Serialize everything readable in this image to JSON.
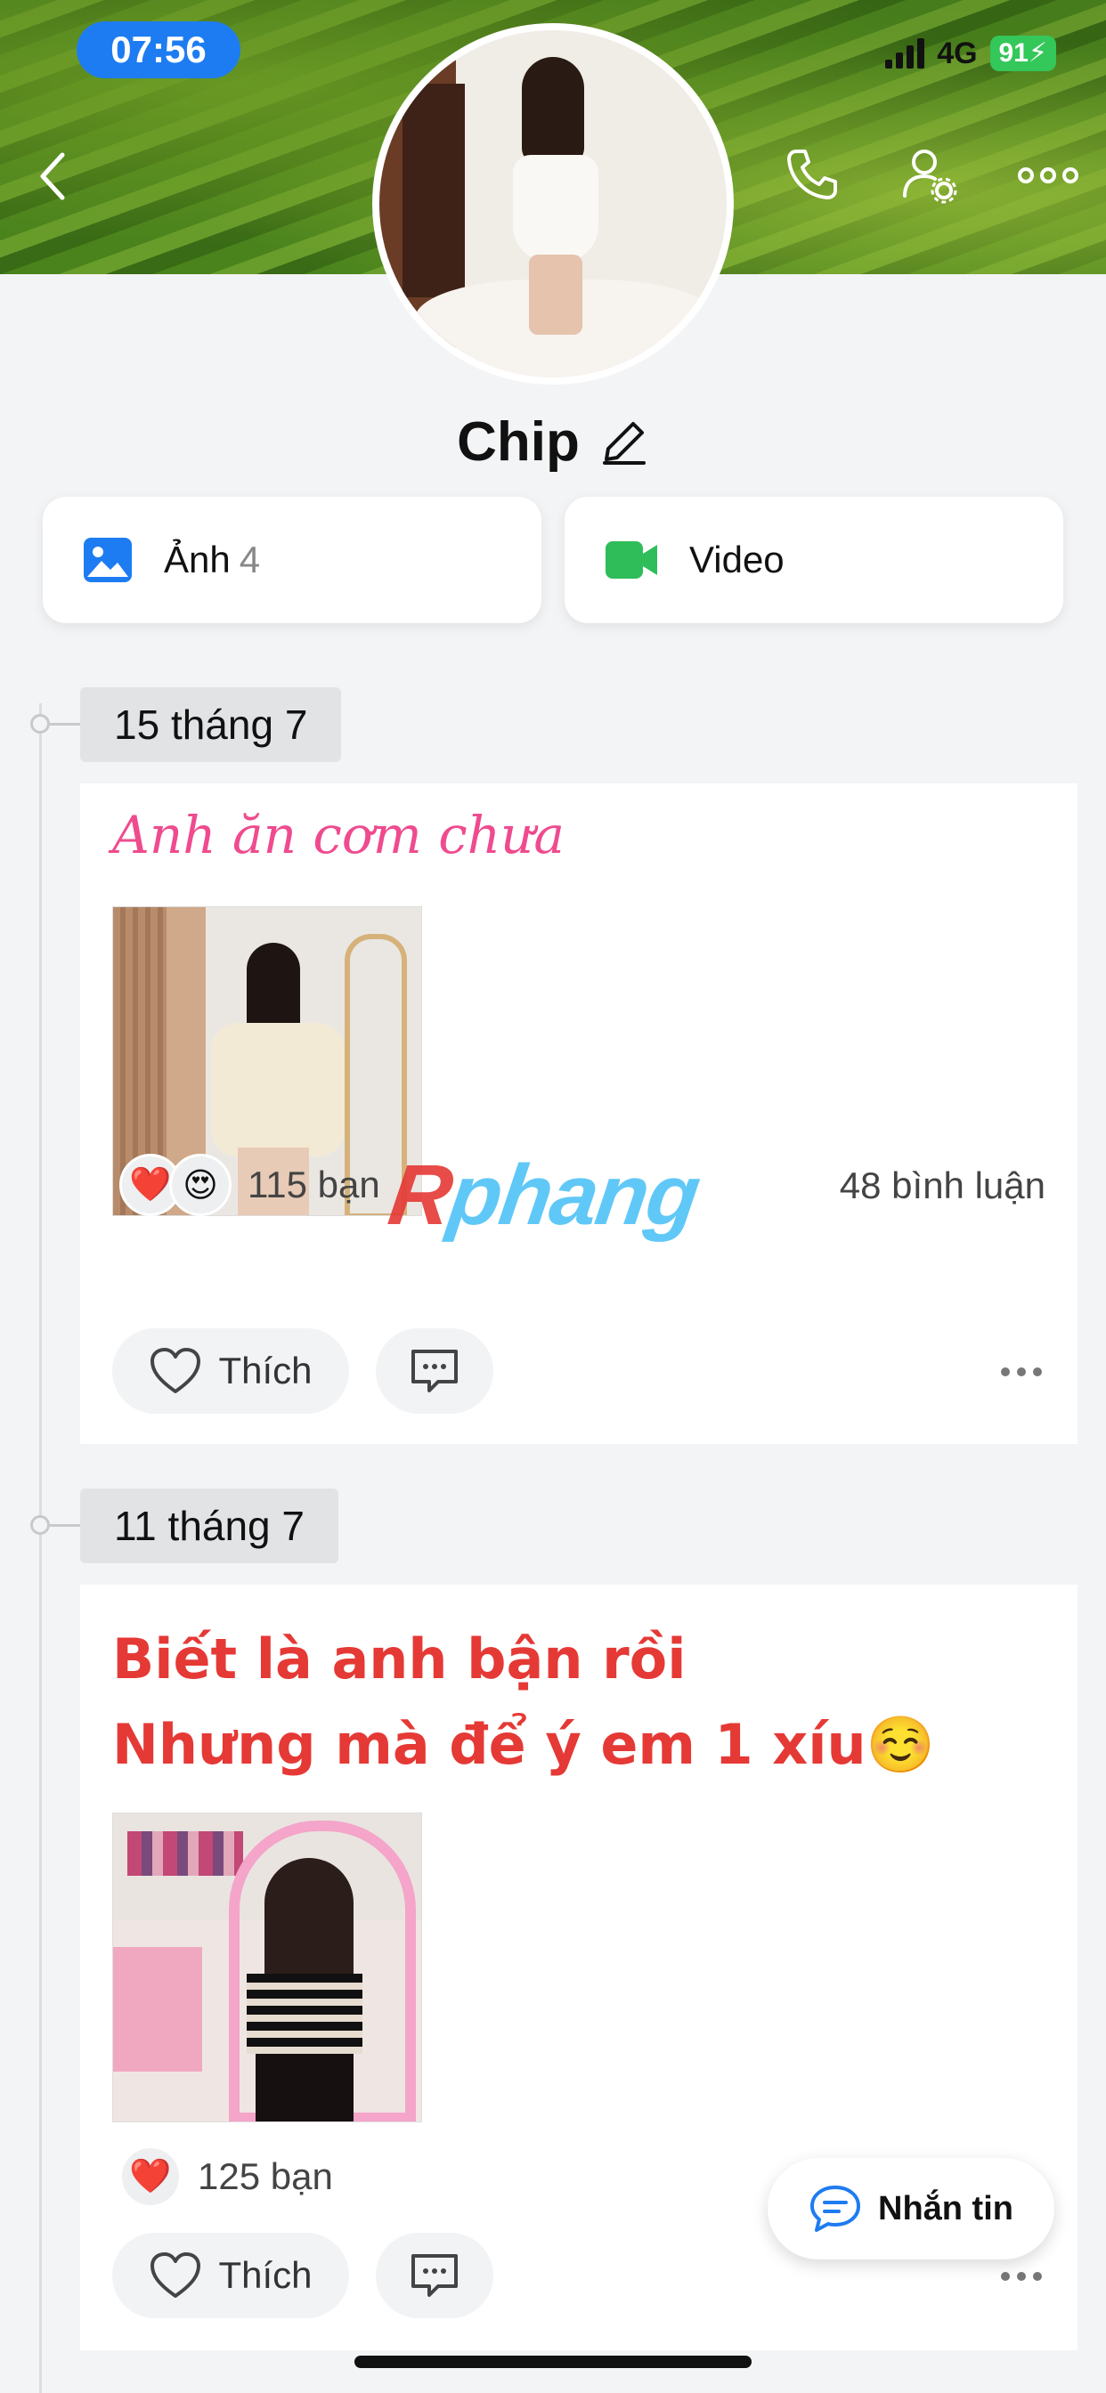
{
  "status_bar": {
    "time": "07:56",
    "network": "4G",
    "battery": "91"
  },
  "header": {
    "back_icon": "chevron-left-icon",
    "call_icon": "phone-icon",
    "settings_icon": "user-settings-icon",
    "more_icon": "more-horizontal-icon"
  },
  "profile": {
    "name": "Chip",
    "edit_icon": "pencil-icon"
  },
  "media": {
    "photos_label": "Ảnh",
    "photos_count": "4",
    "video_label": "Video",
    "photo_icon_color": "#1e7cf2",
    "video_icon_color": "#2ebd59"
  },
  "watermark": {
    "text_first": "R",
    "text_rest": "phang"
  },
  "posts": [
    {
      "date": "15 tháng 7",
      "caption": "Anh ăn cơm chưa",
      "reactions": [
        "heart",
        "heart-eyes"
      ],
      "reaction_count": "115 bạn",
      "comment_count": "48 bình luận",
      "like_label": "Thích"
    },
    {
      "date": "11 tháng 7",
      "caption_line1": "Biết là anh bận rồi",
      "caption_line2": "Nhưng mà để ý em 1 xíu☺️",
      "reactions": [
        "heart"
      ],
      "reaction_count": "125 bạn",
      "like_label": "Thích"
    }
  ],
  "message_button": {
    "label": "Nhắn tin",
    "icon": "chat-icon"
  }
}
